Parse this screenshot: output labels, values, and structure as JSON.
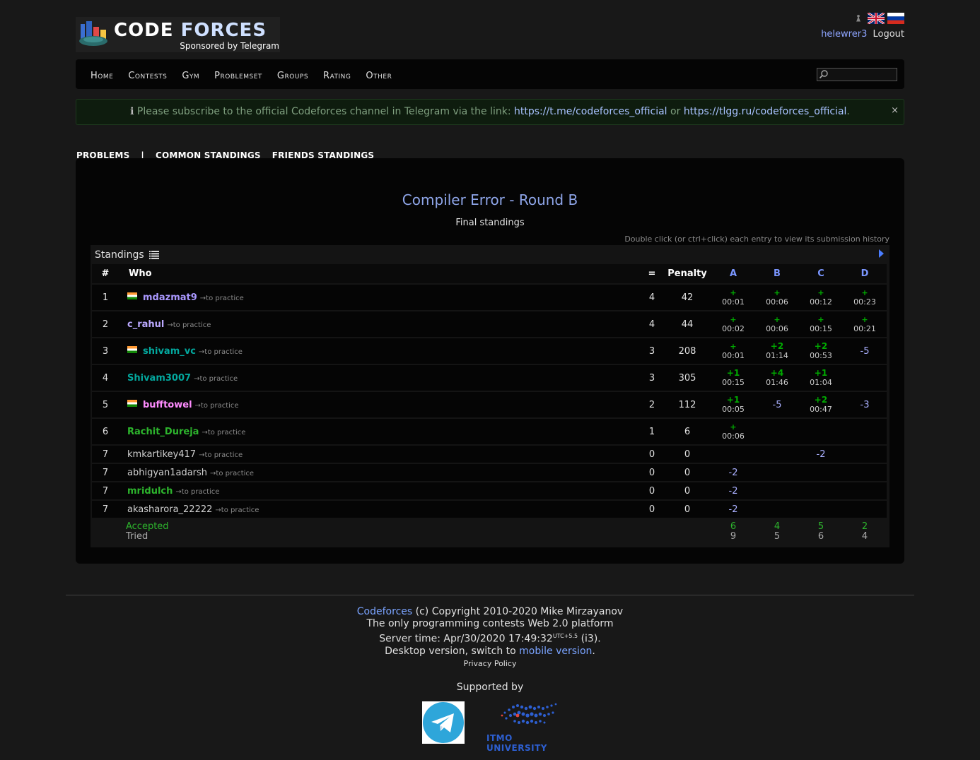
{
  "header": {
    "logo_word1": "CODE",
    "logo_word2": "FORCES",
    "sponsor": "Sponsored by Telegram",
    "username": "helewrer3",
    "logout": "Logout"
  },
  "nav": {
    "items": [
      "Home",
      "Contests",
      "Gym",
      "Problemset",
      "Groups",
      "Rating",
      "Other"
    ],
    "search_value": ""
  },
  "alert": {
    "icon": "ℹ",
    "text_before": " Please subscribe to the official Codeforces channel in Telegram via the link: ",
    "link1": "https://t.me/codeforces_official",
    "text_mid": " or ",
    "link2": "https://tlgg.ru/codeforces_official",
    "text_after": ".",
    "close": "×"
  },
  "submenu": {
    "problems": "PROBLEMS",
    "separator": "|",
    "common": "COMMON STANDINGS",
    "friends": "FRIENDS STANDINGS"
  },
  "contest": {
    "title": "Compiler Error - Round B",
    "subtitle": "Final standings",
    "hint": "Double click (or ctrl+click) each entry to view its submission history",
    "standings_label": "Standings"
  },
  "table": {
    "headers": {
      "rank": "#",
      "who": "Who",
      "solved": "=",
      "penalty": "Penalty",
      "problems": [
        "A",
        "B",
        "C",
        "D"
      ]
    },
    "rows": [
      {
        "rank": "1",
        "handle": "mdazmat9",
        "practice": "→to practice",
        "solved": "4",
        "penalty": "42",
        "cells": [
          [
            "+",
            "00:01"
          ],
          [
            "+",
            "00:06"
          ],
          [
            "+",
            "00:12"
          ],
          [
            "+",
            "00:23"
          ]
        ]
      },
      {
        "rank": "2",
        "handle": "c_rahul",
        "practice": "→to practice",
        "solved": "4",
        "penalty": "44",
        "cells": [
          [
            "+",
            "00:02"
          ],
          [
            "+",
            "00:06"
          ],
          [
            "+",
            "00:15"
          ],
          [
            "+",
            "00:21"
          ]
        ]
      },
      {
        "rank": "3",
        "handle": "shivam_vc",
        "practice": "→to practice",
        "solved": "3",
        "penalty": "208",
        "cells": [
          [
            "+",
            "00:01"
          ],
          [
            "+2",
            "01:14"
          ],
          [
            "+2",
            "00:53"
          ],
          [
            "-5",
            ""
          ]
        ]
      },
      {
        "rank": "4",
        "handle": "Shivam3007",
        "practice": "→to practice",
        "solved": "3",
        "penalty": "305",
        "cells": [
          [
            "+1",
            "00:15"
          ],
          [
            "+4",
            "01:46"
          ],
          [
            "+1",
            "01:04"
          ],
          [
            "",
            ""
          ]
        ]
      },
      {
        "rank": "5",
        "handle": "bufftowel",
        "practice": "→to practice",
        "solved": "2",
        "penalty": "112",
        "cells": [
          [
            "+1",
            "00:05"
          ],
          [
            "-5",
            ""
          ],
          [
            "+2",
            "00:47"
          ],
          [
            "-3",
            ""
          ]
        ]
      },
      {
        "rank": "6",
        "handle": "Rachit_Dureja",
        "practice": "→to practice",
        "solved": "1",
        "penalty": "6",
        "cells": [
          [
            "+",
            "00:06"
          ],
          [
            "",
            ""
          ],
          [
            "",
            ""
          ],
          [
            "",
            ""
          ]
        ]
      },
      {
        "rank": "7",
        "handle": "kmkartikey417",
        "practice": "→to practice",
        "solved": "0",
        "penalty": "0",
        "cells": [
          [
            "",
            ""
          ],
          [
            "",
            ""
          ],
          [
            "-2",
            ""
          ],
          [
            "",
            ""
          ]
        ]
      },
      {
        "rank": "7",
        "handle": "abhigyan1adarsh",
        "practice": "→to practice",
        "solved": "0",
        "penalty": "0",
        "cells": [
          [
            "-2",
            ""
          ],
          [
            "",
            ""
          ],
          [
            "",
            ""
          ],
          [
            "",
            ""
          ]
        ]
      },
      {
        "rank": "7",
        "handle": "mridulch",
        "practice": "→to practice",
        "solved": "0",
        "penalty": "0",
        "cells": [
          [
            "-2",
            ""
          ],
          [
            "",
            ""
          ],
          [
            "",
            ""
          ],
          [
            "",
            ""
          ]
        ]
      },
      {
        "rank": "7",
        "handle": "akasharora_22222",
        "practice": "→to practice",
        "solved": "0",
        "penalty": "0",
        "cells": [
          [
            "-2",
            ""
          ],
          [
            "",
            ""
          ],
          [
            "",
            ""
          ],
          [
            "",
            ""
          ]
        ]
      }
    ],
    "footer": {
      "accepted_label": "Accepted",
      "tried_label": "Tried",
      "accepted": [
        "6",
        "4",
        "5",
        "2"
      ],
      "tried": [
        "9",
        "5",
        "6",
        "4"
      ]
    }
  },
  "footer": {
    "brand": "Codeforces",
    "copyright": " (c) Copyright 2010-2020 Mike Mirzayanov",
    "tagline": "The only programming contests Web 2.0 platform",
    "server_time_prefix": "Server time: Apr/30/2020 17:49:32",
    "server_time_tz": "UTC+5.5",
    "server_time_suffix": " (i3).",
    "desktop_prefix": "Desktop version, switch to ",
    "mobile_link": "mobile version",
    "desktop_suffix": ".",
    "privacy": "Privacy Policy",
    "supported_by": "Supported by",
    "itmo": "ITMO UNIVERSITY"
  },
  "colors": {
    "background": "#181818",
    "panel": "#050505",
    "accepted": "#00aa00",
    "rejected": "#aab0ff",
    "link": "#7aa3ff"
  }
}
